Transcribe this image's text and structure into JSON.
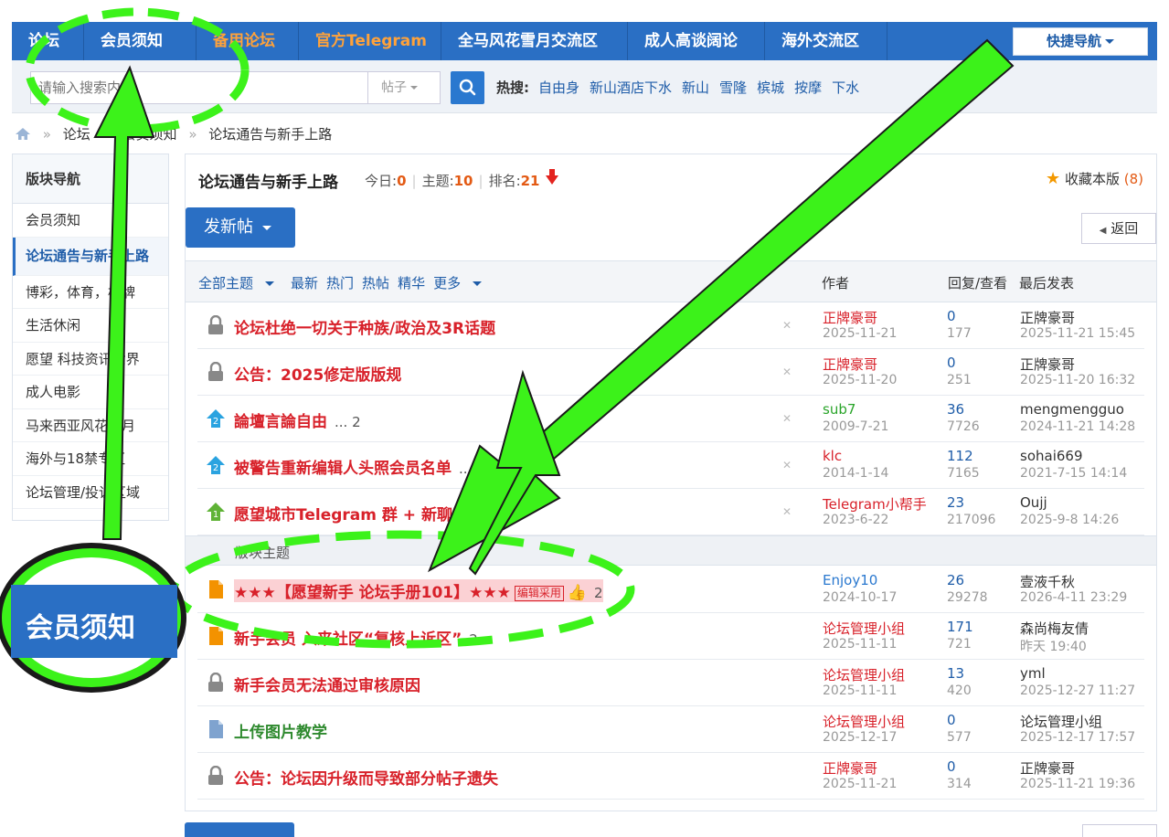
{
  "topnav": {
    "items": [
      {
        "label": "论坛",
        "color": "white"
      },
      {
        "label": "会员须知",
        "color": "white"
      },
      {
        "label": "备用论坛",
        "color": "orange"
      },
      {
        "label": "官方Telegram",
        "color": "orange"
      },
      {
        "label": "全马风花雪月交流区",
        "color": "white"
      },
      {
        "label": "成人高谈阔论",
        "color": "white"
      },
      {
        "label": "海外交流区",
        "color": "white"
      }
    ],
    "quick_nav": "快捷导航"
  },
  "search": {
    "placeholder": "请输入搜索内容",
    "type": "帖子",
    "hot_label": "热搜:",
    "hot_links": [
      "自由身",
      "新山酒店下水",
      "新山",
      "雪隆",
      "槟城",
      "按摩",
      "下水"
    ]
  },
  "breadcrumb": [
    "论坛",
    "会员须知",
    "论坛通告与新手上路"
  ],
  "sidebar": {
    "title": "版块导航",
    "items": [
      {
        "label": "会员须知",
        "active": false
      },
      {
        "label": "论坛通告与新手上路",
        "active": true
      },
      {
        "label": "博彩，体育，棋牌",
        "active": false
      },
      {
        "label": "生活休闲",
        "active": false
      },
      {
        "label": "愿望 科技资讯世界",
        "active": false
      },
      {
        "label": "成人电影",
        "active": false
      },
      {
        "label": "马来西亚风花雪月",
        "active": false
      },
      {
        "label": "海外与18禁专区",
        "active": false
      },
      {
        "label": "论坛管理/投诉区域",
        "active": false
      }
    ]
  },
  "forum": {
    "title": "论坛通告与新手上路",
    "today_label": "今日:",
    "today": "0",
    "topics_label": "主题:",
    "topics": "10",
    "rank_label": "排名:",
    "rank": "21",
    "fav_label": "收藏本版",
    "fav_count": "(8)",
    "new_post": "发新帖",
    "back": "返回"
  },
  "filters": [
    "全部主题",
    "最新",
    "热门",
    "热帖",
    "精华",
    "更多"
  ],
  "columns": {
    "author": "作者",
    "reply": "回复/查看",
    "last": "最后发表"
  },
  "threads": [
    {
      "icon": "lock",
      "title": "论坛杜绝一切关于种族/政治及3R话题",
      "pages": "",
      "author": "正牌豪哥",
      "author_color": "red",
      "date": "2025-11-21",
      "replies": "0",
      "views": "177",
      "last_user": "正牌豪哥",
      "last_time": "2025-11-21 15:45"
    },
    {
      "icon": "lock",
      "title": "公告：2025修定版版规",
      "pages": "",
      "author": "正牌豪哥",
      "author_color": "red",
      "date": "2025-11-20",
      "replies": "0",
      "views": "251",
      "last_user": "正牌豪哥",
      "last_time": "2025-11-20 16:32"
    },
    {
      "icon": "pin2",
      "title": "論壇言論自由",
      "pages": "... 2",
      "author": "sub7",
      "author_color": "green",
      "date": "2009-7-21",
      "replies": "36",
      "views": "7726",
      "last_user": "mengmengguo",
      "last_time": "2024-11-21 14:28"
    },
    {
      "icon": "pin2",
      "title": "被警告重新编辑人头照会员名单",
      "pages": "...",
      "author": "klc",
      "author_color": "red",
      "date": "2014-1-14",
      "replies": "112",
      "views": "7165",
      "last_user": "sohai669",
      "last_time": "2021-7-15 14:14"
    },
    {
      "icon": "pin1",
      "title": "愿望城市Telegram 群 + 新聊天群",
      "pages": "",
      "author": "Telegram小帮手",
      "author_color": "red",
      "date": "2023-6-22",
      "replies": "23",
      "views": "217096",
      "last_user": "Oujj",
      "last_time": "2025-9-8 14:26"
    }
  ],
  "divider": "版块主题",
  "threads2": [
    {
      "icon": "doc-orange",
      "title": "★★★【愿望新手 论坛手册101】★★★",
      "badge": "编辑采用",
      "pages": "2",
      "author": "Enjoy10",
      "author_color": "blue",
      "date": "2024-10-17",
      "replies": "26",
      "views": "29278",
      "last_user": "壹液千秋",
      "last_time": "2026-4-11 23:29",
      "highlight": true
    },
    {
      "icon": "doc-orange",
      "title": "新手会员 入来社区“复核上诉区”",
      "badge": "",
      "pages": "2",
      "author": "论坛管理小组",
      "author_color": "red",
      "date": "2025-11-11",
      "replies": "171",
      "views": "721",
      "last_user": "森尚梅友倩",
      "last_time": "昨天 19:40",
      "highlight": false
    },
    {
      "icon": "lock",
      "title": "新手会员无法通过审核原因",
      "badge": "",
      "pages": "",
      "author": "论坛管理小组",
      "author_color": "red",
      "date": "2025-11-11",
      "replies": "13",
      "views": "420",
      "last_user": "yml",
      "last_time": "2025-12-27 11:27",
      "highlight": false
    },
    {
      "icon": "doc-blue",
      "title": "上传图片教学",
      "badge": "",
      "pages": "",
      "author": "论坛管理小组",
      "author_color": "red",
      "date": "2025-12-17",
      "replies": "0",
      "views": "577",
      "last_user": "论坛管理小组",
      "last_time": "2025-12-17 17:57",
      "highlight": false,
      "green": true
    },
    {
      "icon": "lock",
      "title": "公告：论坛因升级而导致部分帖子遗失",
      "badge": "",
      "pages": "",
      "author": "正牌豪哥",
      "author_color": "red",
      "date": "2025-11-21",
      "replies": "0",
      "views": "314",
      "last_user": "正牌豪哥",
      "last_time": "2025-11-21 19:36",
      "highlight": false
    }
  ],
  "annotation": {
    "zoom_label": "会员须知"
  },
  "colors": {
    "nav": "#2a6fc4",
    "accent_red": "#d8212a",
    "highlight_green": "#3cf21a"
  }
}
